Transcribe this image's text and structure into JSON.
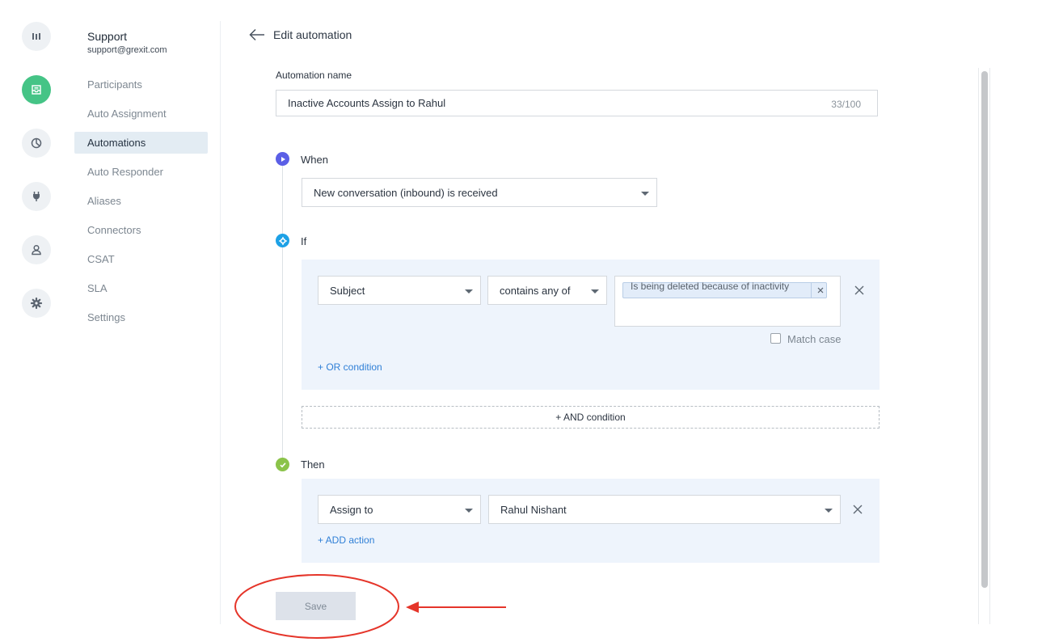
{
  "sidebar": {
    "inbox_name": "Support",
    "inbox_email": "support@grexit.com",
    "items": [
      {
        "label": "Participants"
      },
      {
        "label": "Auto Assignment"
      },
      {
        "label": "Automations"
      },
      {
        "label": "Auto Responder"
      },
      {
        "label": "Aliases"
      },
      {
        "label": "Connectors"
      },
      {
        "label": "CSAT"
      },
      {
        "label": "SLA"
      },
      {
        "label": "Settings"
      }
    ],
    "active_item": "Automations"
  },
  "rail": {
    "icons": [
      "analytics-icon",
      "inbox-icon",
      "reports-icon",
      "integrations-plug-icon",
      "user-icon",
      "settings-gear-icon"
    ],
    "active_icon": "inbox-icon"
  },
  "header": {
    "title": "Edit automation"
  },
  "form": {
    "name_label": "Automation name",
    "name_value": "Inactive Accounts Assign to Rahul",
    "name_counter": "33/100",
    "when": {
      "label": "When",
      "trigger": "New conversation (inbound) is received"
    },
    "if": {
      "label": "If",
      "field": "Subject",
      "operator": "contains any of",
      "tags": [
        "Is being deleted because of inactivity"
      ],
      "match_case_label": "Match case",
      "or_condition": "+ OR condition",
      "and_condition": "+ AND condition"
    },
    "then": {
      "label": "Then",
      "action": "Assign to",
      "assignee": "Rahul Nishant",
      "add_action": "+ ADD action"
    },
    "save_label": "Save"
  },
  "colors": {
    "when_dot": "#5b5fe6",
    "if_dot": "#1da1e6",
    "then_dot": "#8bc34a",
    "active_rail": "#45c486",
    "annotation": "#e5352a",
    "link": "#2f7fd6"
  }
}
